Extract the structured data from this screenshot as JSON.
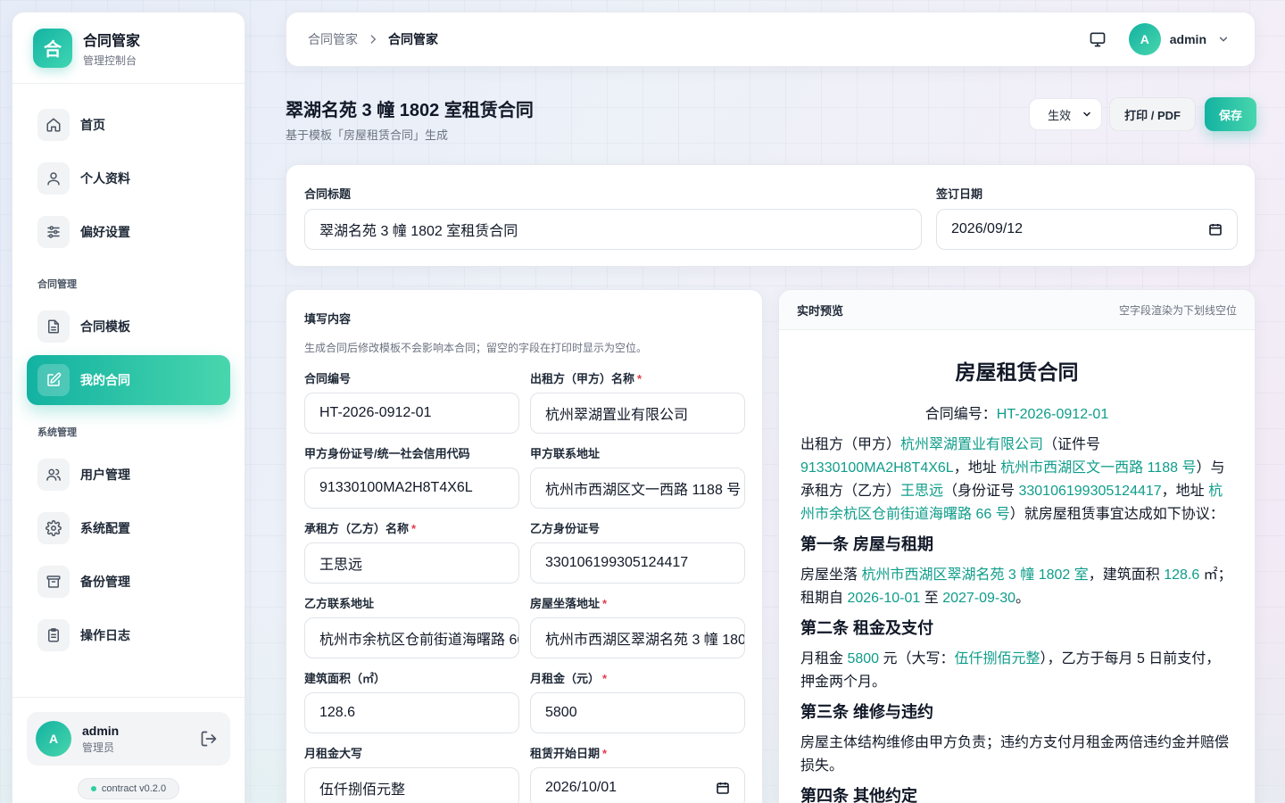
{
  "brand": {
    "logo_char": "合",
    "title": "合同管家",
    "subtitle": "管理控制台"
  },
  "nav": {
    "main": [
      {
        "label": "首页",
        "icon": "home-icon"
      },
      {
        "label": "个人资料",
        "icon": "user-icon"
      },
      {
        "label": "偏好设置",
        "icon": "sliders-icon"
      }
    ],
    "contract_section": "合同管理",
    "contract": [
      {
        "label": "合同模板",
        "icon": "document-icon"
      },
      {
        "label": "我的合同",
        "icon": "edit-icon",
        "active": true
      }
    ],
    "system_section": "系统管理",
    "system": [
      {
        "label": "用户管理",
        "icon": "users-icon"
      },
      {
        "label": "系统配置",
        "icon": "gear-icon"
      },
      {
        "label": "备份管理",
        "icon": "archive-icon"
      },
      {
        "label": "操作日志",
        "icon": "clipboard-icon"
      }
    ]
  },
  "user": {
    "initial": "A",
    "name": "admin",
    "role": "管理员"
  },
  "version": "contract v0.2.0",
  "topbar": {
    "crumb_parent": "合同管家",
    "crumb_current": "合同管家",
    "user_initial": "A",
    "user_name": "admin"
  },
  "page": {
    "title": "翠湖名苑 3 幢 1802 室租赁合同",
    "subtitle": "基于模板「房屋租赁合同」生成"
  },
  "actions": {
    "status": "生效",
    "print": "打印 / PDF",
    "save": "保存"
  },
  "meta": {
    "title_label": "合同标题",
    "title_value": "翠湖名苑 3 幢 1802 室租赁合同",
    "date_label": "签订日期",
    "date_value": "2026/09/12"
  },
  "form": {
    "heading": "填写内容",
    "hint": "生成合同后修改模板不会影响本合同；留空的字段在打印时显示为空位。",
    "fields": [
      {
        "label": "合同编号",
        "value": "HT-2026-0912-01",
        "required": false
      },
      {
        "label": "出租方（甲方）名称",
        "value": "杭州翠湖置业有限公司",
        "required": true
      },
      {
        "label": "甲方身份证号/统一社会信用代码",
        "value": "91330100MA2H8T4X6L",
        "required": false
      },
      {
        "label": "甲方联系地址",
        "value": "杭州市西湖区文一西路 1188 号",
        "required": false
      },
      {
        "label": "承租方（乙方）名称",
        "value": "王思远",
        "required": true
      },
      {
        "label": "乙方身份证号",
        "value": "330106199305124417",
        "required": false
      },
      {
        "label": "乙方联系地址",
        "value": "杭州市余杭区仓前街道海曙路 66 号",
        "required": false
      },
      {
        "label": "房屋坐落地址",
        "value": "杭州市西湖区翠湖名苑 3 幢 1802 室",
        "required": true
      },
      {
        "label": "建筑面积（㎡）",
        "value": "128.6",
        "required": false
      },
      {
        "label": "月租金（元）",
        "value": "5800",
        "required": true
      },
      {
        "label": "月租金大写",
        "value": "伍仟捌佰元整",
        "required": false
      },
      {
        "label": "租赁开始日期",
        "value": "2026/10/01",
        "required": true
      }
    ]
  },
  "preview": {
    "heading": "实时预览",
    "hint": "空字段渲染为下划线空位",
    "doc_title": "房屋租赁合同",
    "no_label": "合同编号：",
    "no": "HT-2026-0912-01",
    "intro": {
      "t1": "出租方（甲方）",
      "lessor": "杭州翠湖置业有限公司",
      "t2": "（证件号 ",
      "lessor_id": "91330100MA2H8T4X6L",
      "t3": "，地址 ",
      "lessor_addr": "杭州市西湖区文一西路 1188 号",
      "t4": "）与承租方（乙方）",
      "lessee": "王思远",
      "t5": "（身份证号 ",
      "lessee_id": "330106199305124417",
      "t6": "，地址 ",
      "lessee_addr": "杭州市余杭区仓前街道海曙路 66 号",
      "t7": "）就房屋租赁事宜达成如下协议："
    },
    "s1_title": "第一条 房屋与租期",
    "s1": {
      "t1": "房屋坐落 ",
      "address": "杭州市西湖区翠湖名苑 3 幢 1802 室",
      "t2": "，建筑面积 ",
      "area": "128.6",
      "t3": " ㎡；租期自 ",
      "start": "2026-10-01",
      "t4": " 至 ",
      "end": "2027-09-30",
      "t5": "。"
    },
    "s2_title": "第二条 租金及支付",
    "s2": {
      "t1": "月租金 ",
      "rent": "5800",
      "t2": " 元（大写：",
      "rent_cn": "伍仟捌佰元整",
      "t3": "），乙方于每月 5 日前支付，押金两个月。"
    },
    "s3_title": "第三条 维修与违约",
    "s3": "房屋主体结构维修由甲方负责；违约方支付月租金两倍违约金并赔偿损失。",
    "s4_title": "第四条 其他约定"
  }
}
